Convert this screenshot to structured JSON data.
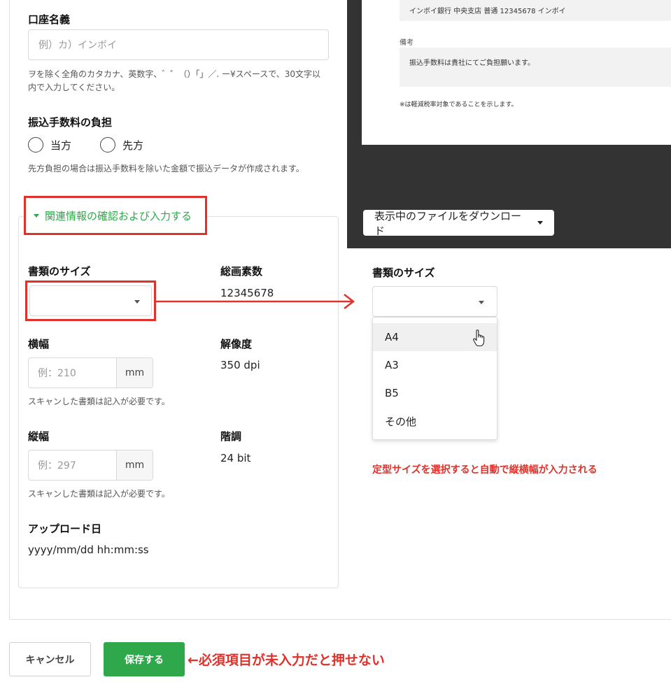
{
  "account_name": {
    "label": "口座名義",
    "placeholder": "例）カ）インボイ",
    "help": "ヲを除く全角のカタカナ、英数字、゛゜（）「」／. ー¥スペースで、30文字以内で入力してください。"
  },
  "fee": {
    "label": "振込手数料の負担",
    "options": [
      "当方",
      "先方"
    ],
    "help": "先方負担の場合は振込手数料を除いた金額で振込データが作成されます。"
  },
  "related_toggle": {
    "label": "関連情報の確認および入力する"
  },
  "doc_size": {
    "label": "書類のサイズ",
    "value": ""
  },
  "total_pixels": {
    "label": "総画素数",
    "value": "12345678"
  },
  "width": {
    "label": "横幅",
    "placeholder": "例：210",
    "unit": "mm",
    "help": "スキャンした書類は記入が必要です。"
  },
  "resolution": {
    "label": "解像度",
    "value": "350 dpi"
  },
  "height": {
    "label": "縦幅",
    "placeholder": "例：297",
    "unit": "mm",
    "help": "スキャンした書類は記入が必要です。"
  },
  "gradation": {
    "label": "階調",
    "value": "24 bit"
  },
  "upload_date": {
    "label": "アップロード日",
    "value": "yyyy/mm/dd hh:mm:ss"
  },
  "preview": {
    "bank_line": "インボイ銀行 中央支店 普通 12345678 インボイ",
    "notes_label": "備考",
    "notes_text": "振込手数料は貴社にてご負担願います。",
    "footnote": "※は軽減税率対象であることを示します。",
    "download_button": "表示中のファイルをダウンロード"
  },
  "dropdown": {
    "label": "書類のサイズ",
    "options": [
      "A4",
      "A3",
      "B5",
      "その他"
    ],
    "hovered": "A4"
  },
  "annotations": {
    "auto_fill": "定型サイズを選択すると自動で縦横幅が入力される",
    "required": "←必須項目が未入力だと押せない"
  },
  "buttons": {
    "cancel": "キャンセル",
    "save": "保存する"
  },
  "colors": {
    "accent_green": "#2ea84a",
    "annotation_red": "#e0322b",
    "dark_panel": "#333333"
  }
}
